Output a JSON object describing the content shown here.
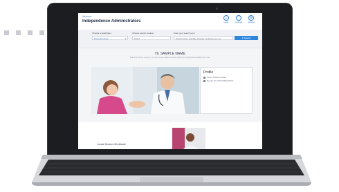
{
  "header": {
    "welcome": "Welcome",
    "brand": "Independence Administrators",
    "icons": [
      {
        "name": "home-icon",
        "label": "Home"
      },
      {
        "name": "favorites-icon",
        "label": "Favorites"
      },
      {
        "name": "settings-icon",
        "label": "Settings"
      }
    ]
  },
  "search": {
    "plan_label": "Choose a healthplan",
    "plan_value": "Personal Choice",
    "location_label": "Choose search location",
    "location_value": "19103",
    "term_label": "Enter your search term",
    "term_placeholder": "Search doctor, specialty, hospital, medical group, etc.",
    "button_label": "Search"
  },
  "welcome_section": {
    "greeting": "Hi, SAMPLE NAME",
    "intro": "Search for doctors near you. You can also use advanced search options to find physicians, facilities and more."
  },
  "profile": {
    "title": "Profile",
    "name_line": "Name: SAMPLE NAME",
    "member_line": "Member ID: XXXXXXXXXXXXXX"
  },
  "lower": {
    "locate_heading": "Locate Doctors Worldwide"
  },
  "colors": {
    "accent": "#2f86de",
    "brand_text": "#1d2a44",
    "laptop_body": "#1c1d20"
  }
}
